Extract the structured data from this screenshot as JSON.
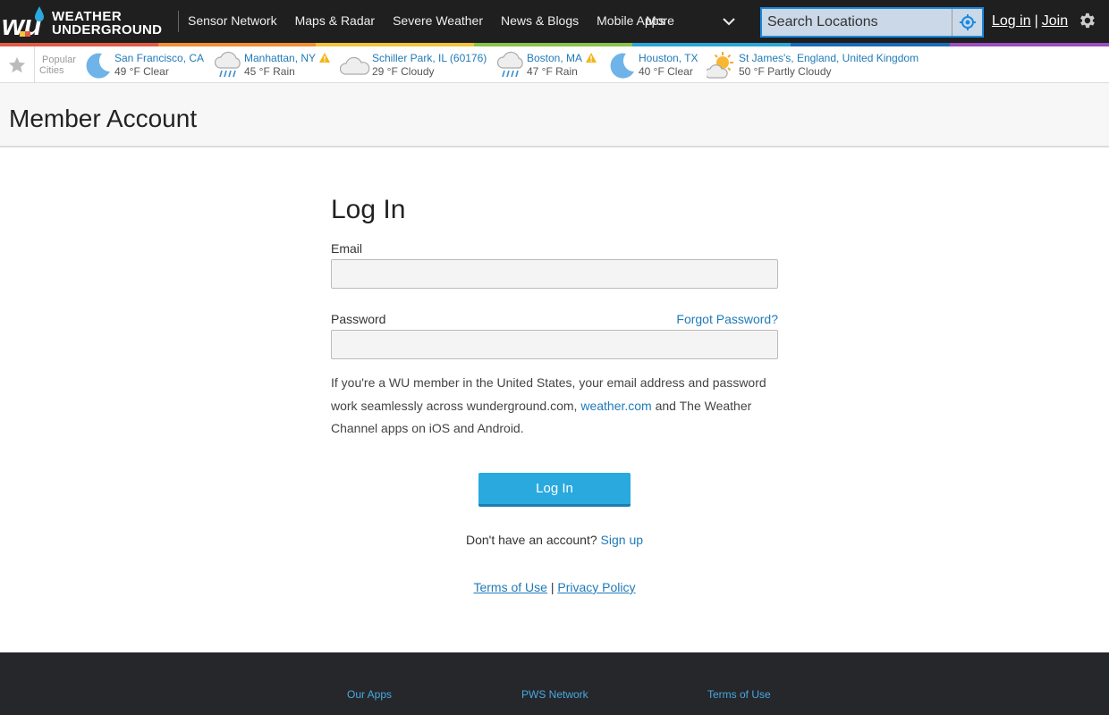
{
  "brand": {
    "logo_mark": "wu",
    "logo_line1": "WEATHER",
    "logo_line2": "UNDERGROUND",
    "colors": {
      "topbar": "#1f1f1f",
      "accent": "#29a9de",
      "link": "#1f7ab8",
      "search_border": "#1a8ae0"
    }
  },
  "nav": {
    "items": [
      {
        "label": "Sensor Network"
      },
      {
        "label": "Maps & Radar"
      },
      {
        "label": "Severe Weather"
      },
      {
        "label": "News & Blogs"
      },
      {
        "label": "Mobile Apps"
      }
    ],
    "more_label": "More",
    "search_placeholder": "Search Locations",
    "login_label": "Log in",
    "separator": "|",
    "join_label": "Join",
    "color_strip": [
      "#e35b46",
      "#f28f35",
      "#f2c53a",
      "#8bc34a",
      "#2aa6d7",
      "#1b6cb6",
      "#9c4dbf"
    ]
  },
  "city_bar": {
    "popular_line1": "Popular",
    "popular_line2": "Cities",
    "cities": [
      {
        "name": "San Francisco, CA",
        "condition": "49 °F Clear",
        "icon": "moon-icon",
        "alert": false
      },
      {
        "name": "Manhattan, NY",
        "condition": "45 °F Rain",
        "icon": "rain-icon",
        "alert": true
      },
      {
        "name": "Schiller Park, IL (60176)",
        "condition": "29 °F Cloudy",
        "icon": "cloud-icon",
        "alert": false
      },
      {
        "name": "Boston, MA",
        "condition": "47 °F Rain",
        "icon": "rain-icon",
        "alert": true
      },
      {
        "name": "Houston, TX",
        "condition": "40 °F Clear",
        "icon": "moon-icon",
        "alert": false
      },
      {
        "name": "St James's, England, United Kingdom",
        "condition": "50 °F Partly Cloudy",
        "icon": "partly-cloudy-icon",
        "alert": false
      }
    ]
  },
  "page": {
    "title": "Member Account"
  },
  "login": {
    "heading": "Log In",
    "email_label": "Email",
    "email_value": "",
    "password_label": "Password",
    "password_value": "",
    "forgot_label": "Forgot Password?",
    "info_text_before": "If you're a WU member in the United States, your email address and password work seamlessly across wunderground.com, ",
    "info_link": "weather.com",
    "info_text_after": " and The Weather Channel apps on iOS and Android.",
    "button_label": "Log In",
    "no_account_text": "Don't have an account?",
    "signup_label": "Sign up",
    "terms_label": "Terms of Use",
    "legal_separator": "|",
    "privacy_label": "Privacy Policy"
  },
  "footer": {
    "links": [
      {
        "label": "Our Apps"
      },
      {
        "label": "PWS Network"
      },
      {
        "label": "Terms of Use"
      }
    ]
  }
}
